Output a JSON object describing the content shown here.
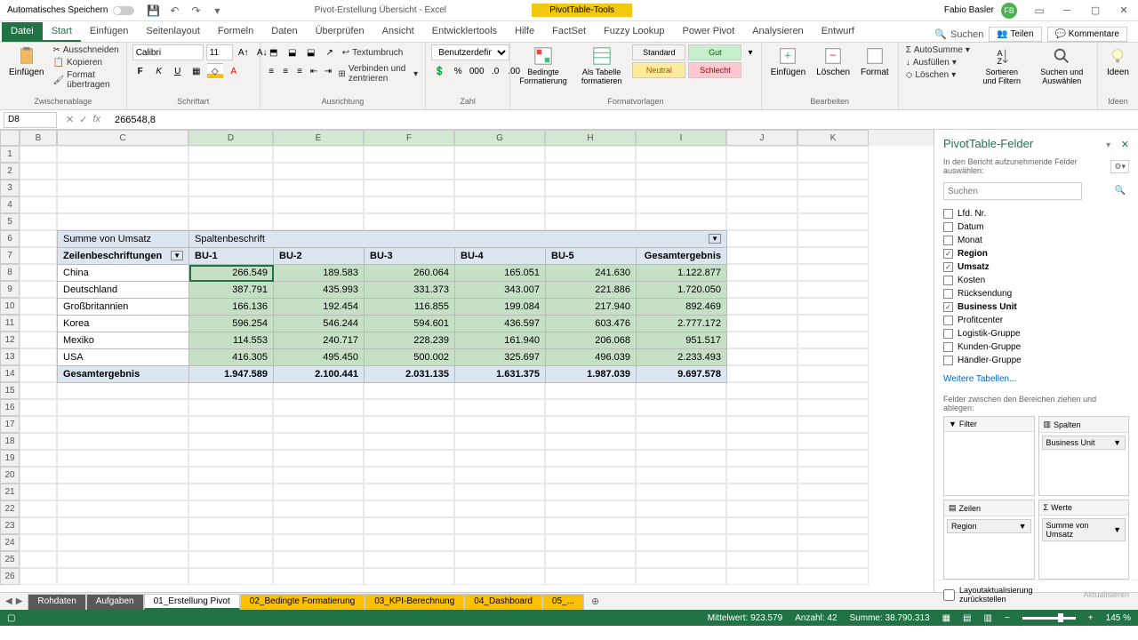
{
  "titlebar": {
    "autosave_label": "Automatisches Speichern",
    "doc_title": "Pivot-Erstellung Übersicht  -  Excel",
    "context_label": "PivotTable-Tools",
    "user_name": "Fabio Basler",
    "user_initials": "FB"
  },
  "ribbon": {
    "tabs": [
      "Datei",
      "Start",
      "Einfügen",
      "Seitenlayout",
      "Formeln",
      "Daten",
      "Überprüfen",
      "Ansicht",
      "Entwicklertools",
      "Hilfe",
      "FactSet",
      "Fuzzy Lookup",
      "Power Pivot",
      "Analysieren",
      "Entwurf"
    ],
    "active_tab": "Start",
    "context_tabs": [
      "Analysieren",
      "Entwurf"
    ],
    "search_label": "Suchen",
    "share_label": "Teilen",
    "comments_label": "Kommentare",
    "clipboard": {
      "paste": "Einfügen",
      "cut": "Ausschneiden",
      "copy": "Kopieren",
      "format_painter": "Format übertragen",
      "group": "Zwischenablage"
    },
    "font": {
      "name": "Calibri",
      "size": "11",
      "group": "Schriftart"
    },
    "alignment": {
      "wrap": "Textumbruch",
      "merge": "Verbinden und zentrieren",
      "group": "Ausrichtung"
    },
    "number": {
      "format": "Benutzerdefiniert",
      "group": "Zahl"
    },
    "styles": {
      "cond": "Bedingte Formatierung",
      "as_table": "Als Tabelle formatieren",
      "items": [
        "Standard",
        "Gut",
        "Neutral",
        "Schlecht"
      ],
      "group": "Formatvorlagen"
    },
    "cells": {
      "insert": "Einfügen",
      "delete": "Löschen",
      "format": "Format",
      "group": "Bearbeiten"
    },
    "editing": {
      "autosum": "AutoSumme",
      "fill": "Ausfüllen",
      "clear": "Löschen",
      "sort": "Sortieren und Filtern",
      "find": "Suchen und Auswählen"
    },
    "ideas": {
      "label": "Ideen",
      "group": "Ideen"
    }
  },
  "formula_bar": {
    "name_box": "D8",
    "value": "266548,8"
  },
  "columns": [
    "B",
    "C",
    "D",
    "E",
    "F",
    "G",
    "H",
    "I",
    "J",
    "K"
  ],
  "selected_cols": [
    "D",
    "E",
    "F",
    "G",
    "H",
    "I"
  ],
  "rows_count": 26,
  "pivot": {
    "sum_label": "Summe von Umsatz",
    "col_label": "Spaltenbeschrift",
    "row_label": "Zeilenbeschriftungen",
    "col_headers": [
      "BU-1",
      "BU-2",
      "BU-3",
      "BU-4",
      "BU-5",
      "Gesamtergebnis"
    ],
    "rows": [
      {
        "label": "China",
        "vals": [
          "266.549",
          "189.583",
          "260.064",
          "165.051",
          "241.630",
          "1.122.877"
        ]
      },
      {
        "label": "Deutschland",
        "vals": [
          "387.791",
          "435.993",
          "331.373",
          "343.007",
          "221.886",
          "1.720.050"
        ]
      },
      {
        "label": "Großbritannien",
        "vals": [
          "166.136",
          "192.454",
          "116.855",
          "199.084",
          "217.940",
          "892.469"
        ]
      },
      {
        "label": "Korea",
        "vals": [
          "596.254",
          "546.244",
          "594.601",
          "436.597",
          "603.476",
          "2.777.172"
        ]
      },
      {
        "label": "Mexiko",
        "vals": [
          "114.553",
          "240.717",
          "228.239",
          "161.940",
          "206.068",
          "951.517"
        ]
      },
      {
        "label": "USA",
        "vals": [
          "416.305",
          "495.450",
          "500.002",
          "325.697",
          "496.039",
          "2.233.493"
        ]
      }
    ],
    "total_label": "Gesamtergebnis",
    "totals": [
      "1.947.589",
      "2.100.441",
      "2.031.135",
      "1.631.375",
      "1.987.039",
      "9.697.578"
    ]
  },
  "field_pane": {
    "title": "PivotTable-Felder",
    "subtitle": "In den Bericht aufzunehmende Felder auswählen:",
    "search_placeholder": "Suchen",
    "fields": [
      {
        "name": "Lfd. Nr.",
        "checked": false
      },
      {
        "name": "Datum",
        "checked": false
      },
      {
        "name": "Monat",
        "checked": false
      },
      {
        "name": "Region",
        "checked": true
      },
      {
        "name": "Umsatz",
        "checked": true
      },
      {
        "name": "Kosten",
        "checked": false
      },
      {
        "name": "Rücksendung",
        "checked": false
      },
      {
        "name": "Business Unit",
        "checked": true
      },
      {
        "name": "Profitcenter",
        "checked": false
      },
      {
        "name": "Logistik-Gruppe",
        "checked": false
      },
      {
        "name": "Kunden-Gruppe",
        "checked": false
      },
      {
        "name": "Händler-Gruppe",
        "checked": false
      }
    ],
    "more_tables": "Weitere Tabellen...",
    "drag_label": "Felder zwischen den Bereichen ziehen und ablegen:",
    "areas": {
      "filter": {
        "label": "Filter",
        "items": []
      },
      "columns": {
        "label": "Spalten",
        "items": [
          "Business Unit"
        ]
      },
      "rows": {
        "label": "Zeilen",
        "items": [
          "Region"
        ]
      },
      "values": {
        "label": "Werte",
        "items": [
          "Summe von Umsatz"
        ]
      }
    },
    "defer_label": "Layoutaktualisierung zurückstellen",
    "update_btn": "Aktualisieren"
  },
  "sheets": {
    "tabs": [
      "Rohdaten",
      "Aufgaben",
      "01_Erstellung Pivot",
      "02_Bedingte Formatierung",
      "03_KPI-Berechnung",
      "04_Dashboard",
      "05_..."
    ],
    "active": "01_Erstellung Pivot",
    "colored": [
      "02_Bedingte Formatierung",
      "03_KPI-Berechnung",
      "04_Dashboard",
      "05_..."
    ]
  },
  "status": {
    "avg_label": "Mittelwert:",
    "avg": "923.579",
    "count_label": "Anzahl:",
    "count": "42",
    "sum_label": "Summe:",
    "sum": "38.790.313",
    "zoom": "145 %"
  }
}
